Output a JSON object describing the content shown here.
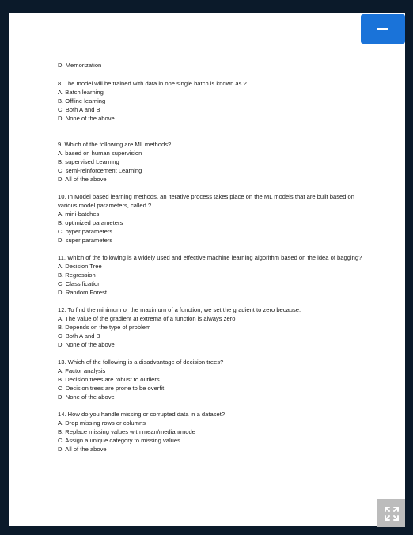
{
  "document": {
    "lead_line": "D. Memorization",
    "questions": [
      {
        "text": "8. The model will be trained with data in one single batch is known as ?",
        "options": [
          "A. Batch learning",
          "B. Offline learning",
          "C. Both A and B",
          "D. None of the above"
        ]
      },
      {
        "text": "9. Which of the following are ML methods?",
        "options": [
          "A. based on human supervision",
          "B. supervised Learning",
          "C. semi-reinforcement Learning",
          "D. All of the above"
        ]
      },
      {
        "text": "10. In Model based learning methods, an iterative process takes place on the ML models that are built based on various model parameters, called ?",
        "options": [
          "A. mini-batches",
          "B. optimized parameters",
          "C. hyper parameters",
          "D. super parameters"
        ]
      },
      {
        "text": "11. Which of the following is a widely used and effective machine learning algorithm based on the idea of bagging?",
        "options": [
          "A. Decision Tree",
          "B. Regression",
          "C. Classification",
          "D. Random Forest"
        ]
      },
      {
        "text": "12. To find the minimum or the maximum of a function, we set the gradient to zero because:",
        "options": [
          "A. The value of the gradient at extrema of a function is always zero",
          "B. Depends on the type of problem",
          "C. Both A and B",
          "D. None of the above"
        ]
      },
      {
        "text": "13. Which of the following is a disadvantage of decision trees?",
        "options": [
          "A. Factor analysis",
          "B. Decision trees are robust to outliers",
          "C. Decision trees are prone to be overfit",
          "D. None of the above"
        ]
      },
      {
        "text": "14. How do you handle missing or corrupted data in a dataset?",
        "options": [
          "A. Drop missing rows or columns",
          "B. Replace missing values with mean/median/mode",
          "C. Assign a unique category to missing values",
          "D. All of the above"
        ]
      }
    ]
  },
  "controls": {
    "menu_icon": "minus-icon",
    "expand_icon": "expand-arrows-icon"
  },
  "colors": {
    "backdrop": "#0b1a2a",
    "page": "#ffffff",
    "accent": "#1a73d9",
    "expand_button": "#bcbcbc"
  }
}
